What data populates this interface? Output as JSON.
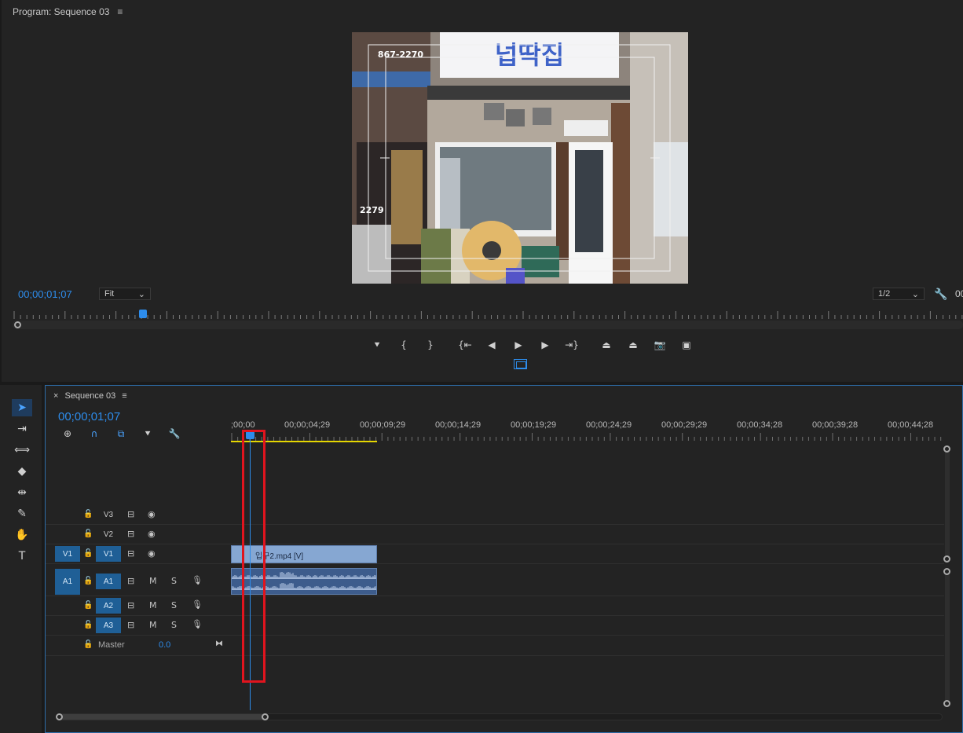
{
  "program": {
    "title": "Program: Sequence 03",
    "menu_glyph": "≡",
    "timecode": "00;00;01;07",
    "zoom_select": "Fit",
    "resolution_select": "1/2",
    "right_timecode_cut": "00",
    "playhead_position": 0.14,
    "sign_text": "넙딱집",
    "sign_phone": "867-2270",
    "side_sign_text": "2279",
    "transport": [
      {
        "name": "add-marker-button",
        "glyph": "⯆"
      },
      {
        "name": "mark-in-button",
        "glyph": "{"
      },
      {
        "name": "mark-out-button",
        "glyph": "}"
      },
      {
        "name": "go-to-in-button",
        "glyph": "{⇤"
      },
      {
        "name": "step-back-button",
        "glyph": "◀"
      },
      {
        "name": "play-button",
        "glyph": "▶"
      },
      {
        "name": "step-forward-button",
        "glyph": "▶"
      },
      {
        "name": "go-to-out-button",
        "glyph": "⇥}"
      },
      {
        "name": "lift-button",
        "glyph": "⏏"
      },
      {
        "name": "extract-button",
        "glyph": "⏏"
      },
      {
        "name": "export-frame-button",
        "glyph": "📷"
      },
      {
        "name": "comparison-view-button",
        "glyph": "▣"
      }
    ]
  },
  "timeline": {
    "tab_close": "×",
    "tab_title": "Sequence 03",
    "menu_glyph": "≡",
    "timecode": "00;00;01;07",
    "ruler_labels": [
      ";00;00",
      "00;00;04;29",
      "00;00;09;29",
      "00;00;14;29",
      "00;00;19;29",
      "00;00;24;29",
      "00;00;29;29",
      "00;00;34;28",
      "00;00;39;28",
      "00;00;44;28"
    ],
    "video_tracks": [
      {
        "src": "",
        "target": "V3",
        "target_on": false,
        "lock": "🔓"
      },
      {
        "src": "",
        "target": "V2",
        "target_on": false,
        "lock": "🔓"
      },
      {
        "src": "V1",
        "target": "V1",
        "target_on": true,
        "lock": "🔓"
      }
    ],
    "audio_tracks": [
      {
        "src": "A1",
        "target": "A1",
        "mute": "M",
        "solo": "S"
      },
      {
        "src": "",
        "target": "A2",
        "mute": "M",
        "solo": "S"
      },
      {
        "src": "",
        "target": "A3",
        "mute": "M",
        "solo": "S"
      }
    ],
    "video_clip_label": "입구2.mp4 [V]",
    "master_label": "Master",
    "master_value": "0.0"
  },
  "colors": {
    "accent_blue": "#2d8ceb",
    "track_target": "#1f5f96",
    "video_clip": "#86a7d2",
    "audio_clip": "#3d5c8c",
    "work_area": "#e5d600",
    "highlight_box": "#e1141e"
  }
}
